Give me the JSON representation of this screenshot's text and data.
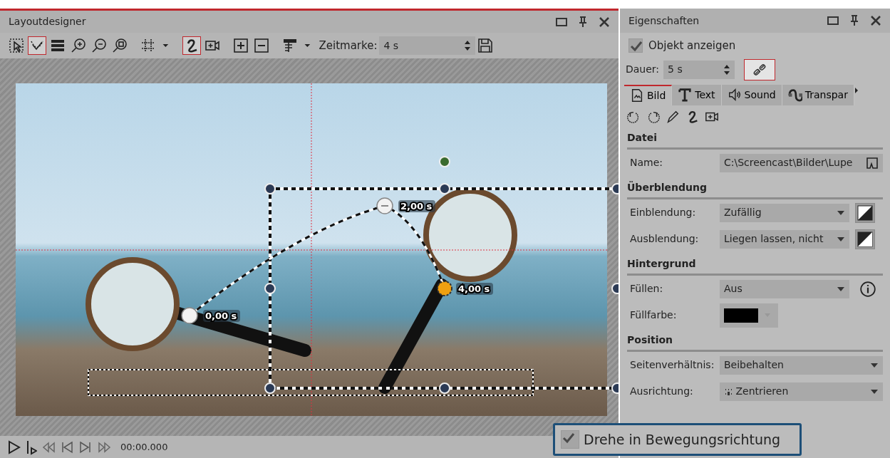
{
  "layout_designer": {
    "title": "Layoutdesigner",
    "toolbar": [
      {
        "kind": "select",
        "selected": false
      },
      {
        "kind": "path",
        "selected": true
      },
      {
        "kind": "layers",
        "selected": false
      },
      {
        "kind": "zoom-in",
        "selected": false
      },
      {
        "kind": "zoom-out",
        "selected": false
      },
      {
        "kind": "zoom-fit",
        "selected": false
      },
      {
        "kind": "grid",
        "selected": false
      },
      {
        "kind": "caret",
        "selected": false
      },
      {
        "kind": "curve",
        "selected": true
      },
      {
        "kind": "camera",
        "selected": false
      },
      {
        "kind": "add",
        "selected": false
      },
      {
        "kind": "remove",
        "selected": false
      },
      {
        "kind": "align",
        "selected": false
      },
      {
        "kind": "caret",
        "selected": false
      }
    ],
    "zeitmarke": {
      "label": "Zeitmarke:",
      "value": "4 s"
    },
    "canvas": {
      "time_labels": [
        "0,00 s",
        "2,00 s",
        "4,00 s"
      ]
    },
    "playback": {
      "timecode": "00:00.000"
    }
  },
  "properties": {
    "title": "Eigenschaften",
    "show_object": {
      "label": "Objekt anzeigen",
      "checked": true
    },
    "duration": {
      "label": "Dauer:",
      "value": "5 s",
      "link_selected": true
    },
    "tabs": [
      {
        "label": "Bild",
        "kind": "image",
        "selected": true
      },
      {
        "label": "Text",
        "kind": "text",
        "selected": false
      },
      {
        "label": "Sound",
        "kind": "sound",
        "selected": false
      },
      {
        "label": "Transpar",
        "kind": "transparency",
        "selected": false
      }
    ],
    "tools": [
      {
        "kind": "rotate-left"
      },
      {
        "kind": "rotate-right"
      },
      {
        "kind": "pen"
      },
      {
        "kind": "curve"
      },
      {
        "kind": "camera"
      }
    ],
    "sections": [
      {
        "title": "Datei",
        "rows": [
          {
            "label": "Name:",
            "kind": "file",
            "value": "C:\\Screencast\\Bilder\\Lupe"
          }
        ]
      },
      {
        "title": "Überblendung",
        "rows": [
          {
            "label": "Einblendung:",
            "kind": "select",
            "value": "Zufällig",
            "extra": {
              "kind": "fade-in"
            }
          },
          {
            "label": "Ausblendung:",
            "kind": "select",
            "value": "Liegen lassen, nicht",
            "extra": {
              "kind": "fade-out"
            }
          }
        ]
      },
      {
        "title": "Hintergrund",
        "rows": [
          {
            "label": "Füllen:",
            "kind": "select",
            "value": "Aus",
            "extra": {
              "kind": "info"
            }
          },
          {
            "label": "Füllfarbe:",
            "kind": "color",
            "color": "#000000"
          }
        ]
      },
      {
        "title": "Position",
        "rows": [
          {
            "label": "Seitenverhältnis:",
            "kind": "select",
            "value": "Beibehalten"
          },
          {
            "label": "Ausrichtung:",
            "kind": "select",
            "value": "Zentrieren",
            "icon": true
          }
        ]
      }
    ]
  },
  "popup": {
    "label": "Drehe in Bewegungsrichtung",
    "checked": true
  }
}
